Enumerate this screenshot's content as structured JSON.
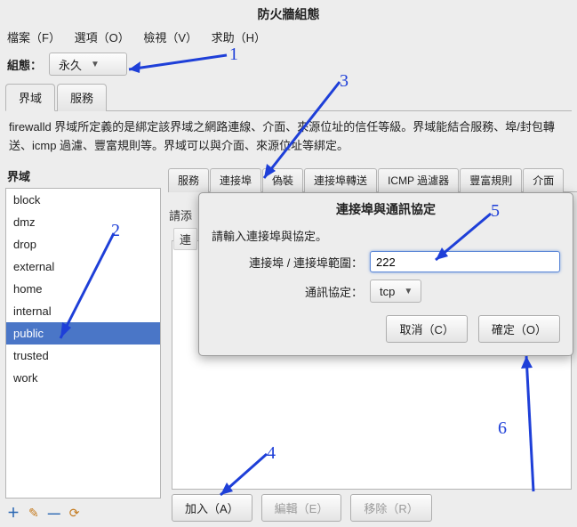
{
  "title": "防火牆組態",
  "menu": {
    "file": "檔案（F）",
    "options": "選項（O）",
    "view": "檢視（V）",
    "help": "求助（H）"
  },
  "config": {
    "label": "組態：",
    "value": "永久"
  },
  "outerTabs": {
    "zones": "界域",
    "services": "服務"
  },
  "description": "firewalld 界域所定義的是綁定該界域之網路連線、介面、來源位址的信任等級。界域能結合服務、埠/封包轉送、icmp 過濾、豐富規則等。界域可以與介面、來源位址等綁定。",
  "zonesHeader": "界域",
  "zones": [
    "block",
    "dmz",
    "drop",
    "external",
    "home",
    "internal",
    "public",
    "trusted",
    "work"
  ],
  "selectedZone": "public",
  "leftIcons": {
    "add": "＋",
    "edit": "✎",
    "remove": "—",
    "reload": "⟳"
  },
  "rightTabs": {
    "services": "服務",
    "ports": "連接埠",
    "masq": "偽裝",
    "forward": "連接埠轉送",
    "icmp": "ICMP 過濾器",
    "rich": "豐富規則",
    "iface": "介面"
  },
  "portsHint": "請添",
  "portsColumn": "連",
  "bottom": {
    "add": "加入（A）",
    "edit": "編輯（E）",
    "remove": "移除（R）"
  },
  "dialog": {
    "title": "連接埠與通訊協定",
    "prompt": "請輸入連接埠與協定。",
    "portLabel": "連接埠 / 連接埠範圍：",
    "portValue": "222",
    "protoLabel": "通訊協定：",
    "protoValue": "tcp",
    "cancel": "取消（C）",
    "ok": "確定（O）"
  },
  "annotations": {
    "1": "1",
    "2": "2",
    "3": "3",
    "4": "4",
    "5": "5",
    "6": "6"
  }
}
